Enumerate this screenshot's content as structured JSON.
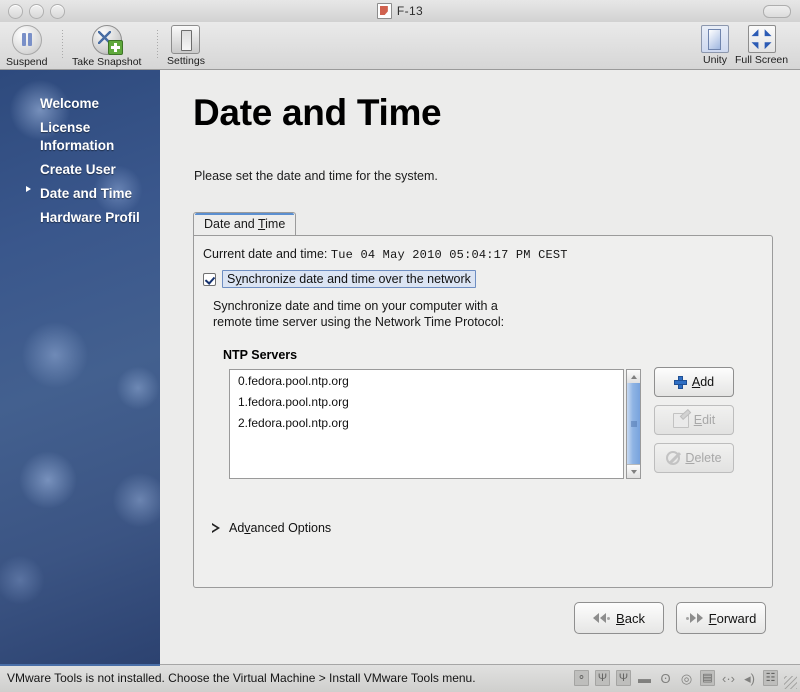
{
  "window": {
    "title": "F-13",
    "doc_icon": "document-icon"
  },
  "toolbar": {
    "items": [
      {
        "label": "Suspend",
        "icon": "suspend-icon"
      },
      {
        "label": "Take Snapshot",
        "icon": "snapshot-icon"
      },
      {
        "label": "Settings",
        "icon": "settings-icon"
      }
    ],
    "right_items": [
      {
        "label": "Unity",
        "icon": "unity-icon"
      },
      {
        "label": "Full Screen",
        "icon": "fullscreen-icon"
      }
    ]
  },
  "sidebar": {
    "items": [
      {
        "label": "Welcome",
        "selected": false
      },
      {
        "label": "License Information",
        "line1": "License",
        "line2": "Information",
        "selected": false
      },
      {
        "label": "Create User",
        "selected": false
      },
      {
        "label": "Date and Time",
        "selected": true
      },
      {
        "label": "Hardware Profil",
        "selected": false
      }
    ]
  },
  "main": {
    "title": "Date and Time",
    "subtitle": "Please set the date and time for the system.",
    "tab_label_pre": "Date and ",
    "tab_label_key": "T",
    "tab_label_post": "ime",
    "current_label": "Current date and time:",
    "current_value": "Tue 04 May 2010 05:04:17 PM CEST",
    "sync_pre": "S",
    "sync_key": "y",
    "sync_post": "nchronize date and time over the network",
    "sync_checked": true,
    "description_line1": "Synchronize date and time on your computer with a",
    "description_line2": "remote time server using the Network Time Protocol:",
    "ntp_heading": "NTP Servers",
    "ntp_servers": [
      "0.fedora.pool.ntp.org",
      "1.fedora.pool.ntp.org",
      "2.fedora.pool.ntp.org"
    ],
    "buttons": {
      "add": {
        "pre": "",
        "key": "A",
        "post": "dd",
        "icon": "plus-icon",
        "enabled": true
      },
      "edit": {
        "pre": "",
        "key": "E",
        "post": "dit",
        "icon": "edit-icon",
        "enabled": false
      },
      "delete": {
        "pre": "",
        "key": "D",
        "post": "elete",
        "icon": "delete-icon",
        "enabled": false
      }
    },
    "advanced": {
      "pre": "Ad",
      "key": "v",
      "post": "anced Options",
      "icon": "disclosure-triangle-icon",
      "expanded": false
    },
    "back": {
      "pre": "",
      "key": "B",
      "post": "ack",
      "icon": "chevron-left-icon"
    },
    "forward": {
      "pre": "",
      "key": "F",
      "post": "orward",
      "icon": "chevron-right-icon"
    }
  },
  "statusbar": {
    "message": "VMware Tools is not installed. Choose the Virtual Machine > Install VMware Tools menu.",
    "tray_icons": [
      {
        "name": "camera-icon",
        "glyph": "⚬"
      },
      {
        "name": "usb-icon",
        "glyph": "Ψ"
      },
      {
        "name": "usb-2-icon",
        "glyph": "Ψ"
      },
      {
        "name": "battery-icon",
        "glyph": "▬"
      },
      {
        "name": "bluetooth-icon",
        "glyph": "ʘ"
      },
      {
        "name": "cdrom-icon",
        "glyph": "◎"
      },
      {
        "name": "harddisk-icon",
        "glyph": "▤"
      },
      {
        "name": "network-icon",
        "glyph": "‹·›"
      },
      {
        "name": "sound-icon",
        "glyph": "◂)"
      },
      {
        "name": "shared-folder-icon",
        "glyph": "☷"
      }
    ]
  },
  "colors": {
    "accent_blue": "#5b8fd0",
    "wallpaper_blue": "#3a578c",
    "panel_bg": "#efefee",
    "selection_blue": "#dbe4f3"
  }
}
